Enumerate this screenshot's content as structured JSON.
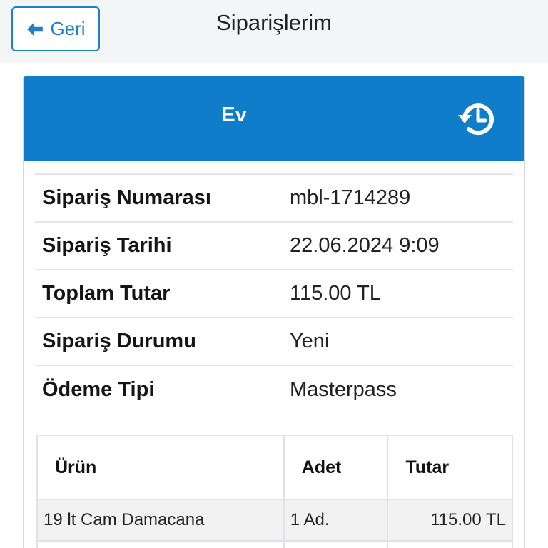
{
  "topbar": {
    "back_label": "Geri",
    "title": "Siparişlerim"
  },
  "card": {
    "title": "Ev",
    "header_color": "#0f7dc9",
    "icon": "history-icon"
  },
  "details": [
    {
      "label": "Sipariş Numarası",
      "value": "mbl-1714289"
    },
    {
      "label": "Sipariş Tarihi",
      "value": "22.06.2024 9:09"
    },
    {
      "label": "Toplam Tutar",
      "value": "115.00 TL"
    },
    {
      "label": "Sipariş Durumu",
      "value": "Yeni"
    },
    {
      "label": "Ödeme Tipi",
      "value": "Masterpass"
    }
  ],
  "items_table": {
    "headers": [
      "Ürün",
      "Adet",
      "Tutar"
    ],
    "rows": [
      {
        "product": "19 lt Cam Damacana",
        "qty": "1 Ad.",
        "amount": "115.00 TL"
      }
    ]
  }
}
